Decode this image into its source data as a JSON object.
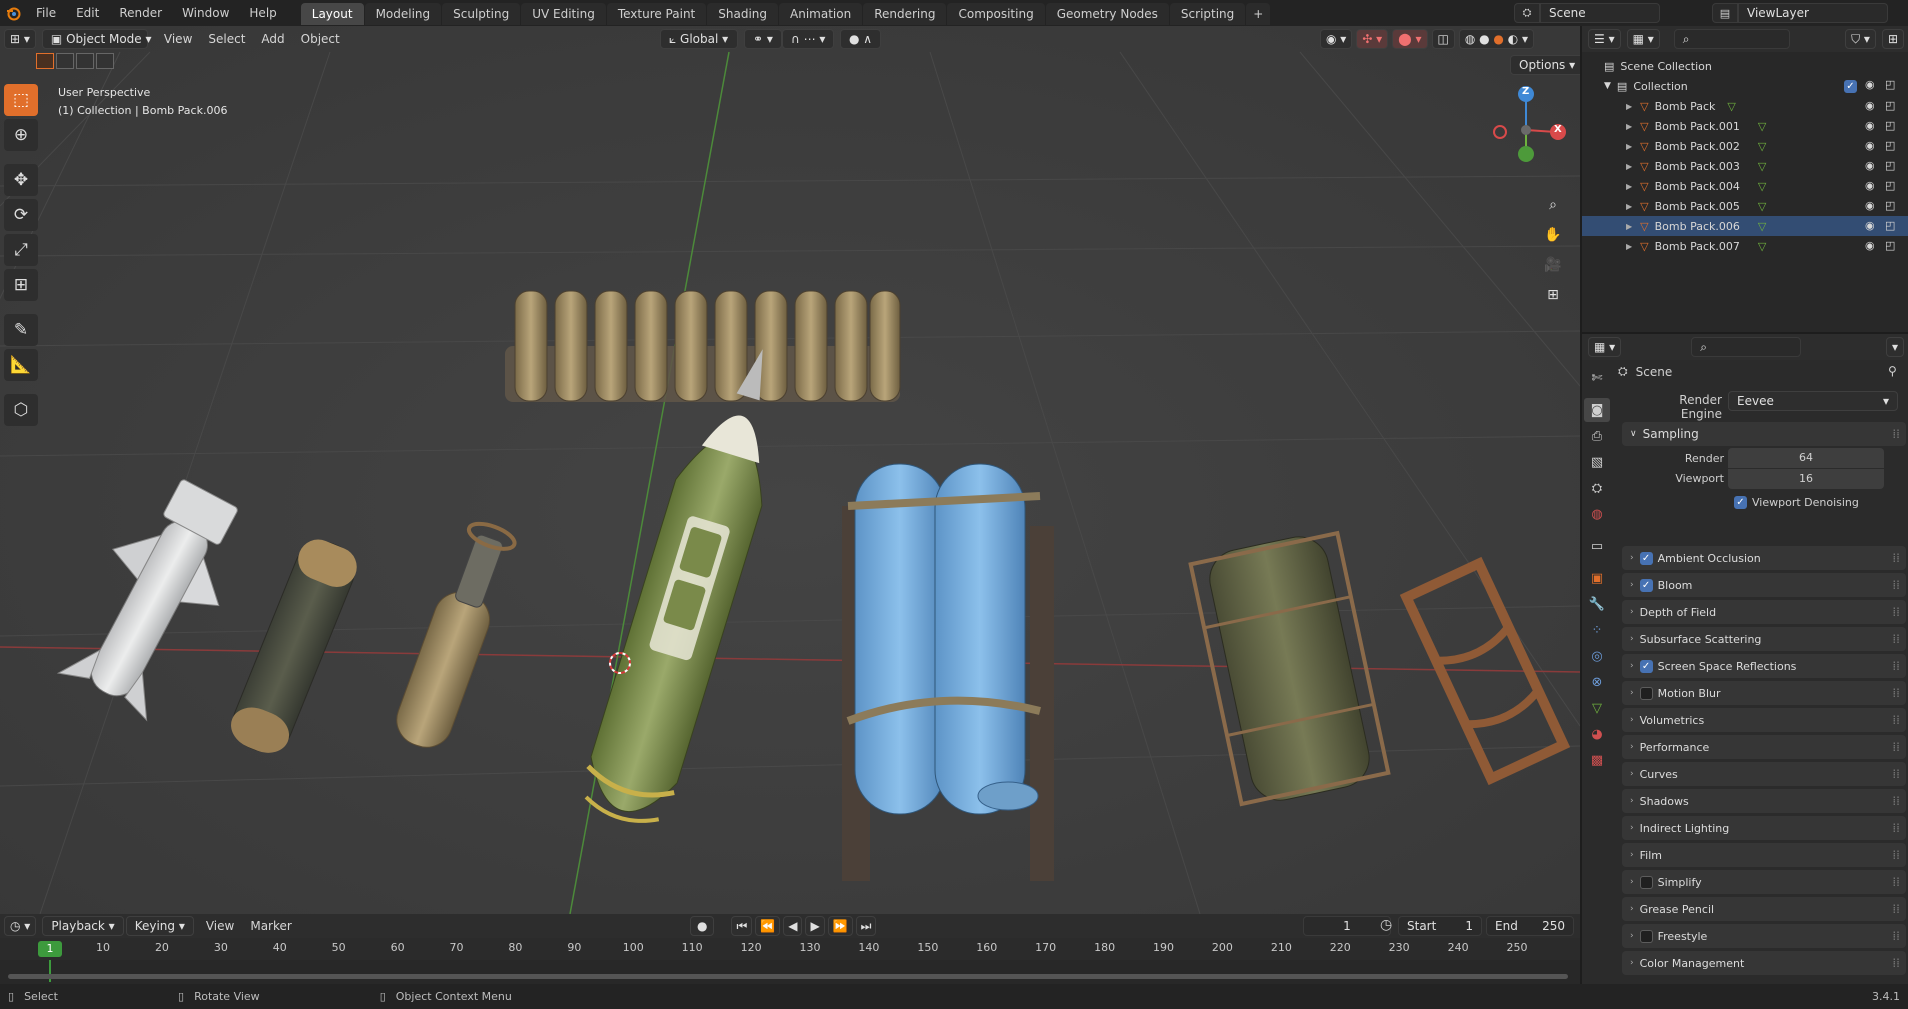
{
  "topbar": {
    "menus": [
      "File",
      "Edit",
      "Render",
      "Window",
      "Help"
    ],
    "workspaces": [
      "Layout",
      "Modeling",
      "Sculpting",
      "UV Editing",
      "Texture Paint",
      "Shading",
      "Animation",
      "Rendering",
      "Compositing",
      "Geometry Nodes",
      "Scripting"
    ],
    "active_workspace": "Layout",
    "add_tab": "+",
    "scene": "Scene",
    "view_layer": "ViewLayer"
  },
  "viewport": {
    "mode": "Object Mode",
    "menus": [
      "View",
      "Select",
      "Add",
      "Object"
    ],
    "orientation": "Global",
    "options_label": "Options",
    "overlay_title": "User Perspective",
    "overlay_subtitle": "(1) Collection | Bomb Pack.006",
    "axis_labels": {
      "z": "Z",
      "y": "Y",
      "x": "X"
    }
  },
  "outliner": {
    "root": "Scene Collection",
    "collection": "Collection",
    "objects": [
      "Bomb Pack",
      "Bomb Pack.001",
      "Bomb Pack.002",
      "Bomb Pack.003",
      "Bomb Pack.004",
      "Bomb Pack.005",
      "Bomb Pack.006",
      "Bomb Pack.007"
    ],
    "active_object": "Bomb Pack.006"
  },
  "properties": {
    "context": "Scene",
    "render_engine_label": "Render Engine",
    "render_engine": "Eevee",
    "sampling": {
      "label": "Sampling",
      "render_label": "Render",
      "render_value": "64",
      "viewport_label": "Viewport",
      "viewport_value": "16",
      "denoise_label": "Viewport Denoising"
    },
    "panels": [
      {
        "label": "Ambient Occlusion",
        "checkbox": true,
        "checked": true
      },
      {
        "label": "Bloom",
        "checkbox": true,
        "checked": true
      },
      {
        "label": "Depth of Field",
        "checkbox": false,
        "checked": false
      },
      {
        "label": "Subsurface Scattering",
        "checkbox": false,
        "checked": false
      },
      {
        "label": "Screen Space Reflections",
        "checkbox": true,
        "checked": true
      },
      {
        "label": "Motion Blur",
        "checkbox": true,
        "checked": false
      },
      {
        "label": "Volumetrics",
        "checkbox": false,
        "checked": false
      },
      {
        "label": "Performance",
        "checkbox": false,
        "checked": false
      },
      {
        "label": "Curves",
        "checkbox": false,
        "checked": false
      },
      {
        "label": "Shadows",
        "checkbox": false,
        "checked": false
      },
      {
        "label": "Indirect Lighting",
        "checkbox": false,
        "checked": false
      },
      {
        "label": "Film",
        "checkbox": false,
        "checked": false
      },
      {
        "label": "Simplify",
        "checkbox": true,
        "checked": false
      },
      {
        "label": "Grease Pencil",
        "checkbox": false,
        "checked": false
      },
      {
        "label": "Freestyle",
        "checkbox": true,
        "checked": false
      },
      {
        "label": "Color Management",
        "checkbox": false,
        "checked": false
      }
    ]
  },
  "timeline": {
    "menus": [
      "Playback",
      "Keying",
      "View",
      "Marker"
    ],
    "current_frame": "1",
    "start_label": "Start",
    "start": "1",
    "end_label": "End",
    "end": "250",
    "ruler_ticks": [
      "10",
      "20",
      "30",
      "40",
      "50",
      "60",
      "70",
      "80",
      "90",
      "100",
      "110",
      "120",
      "130",
      "140",
      "150",
      "160",
      "170",
      "180",
      "190",
      "200",
      "210",
      "220",
      "230",
      "240",
      "250"
    ],
    "playhead_label": "1"
  },
  "statusbar": {
    "select": "Select",
    "rotate": "Rotate View",
    "context_menu": "Object Context Menu",
    "version": "3.4.1"
  },
  "colors": {
    "accent": "#e16f2b",
    "selected_blue": "#4772b3",
    "axis_x": "#d84a4a",
    "axis_y": "#6fb23e",
    "axis_z": "#3f89d6",
    "playhead": "#3d9a3d"
  }
}
